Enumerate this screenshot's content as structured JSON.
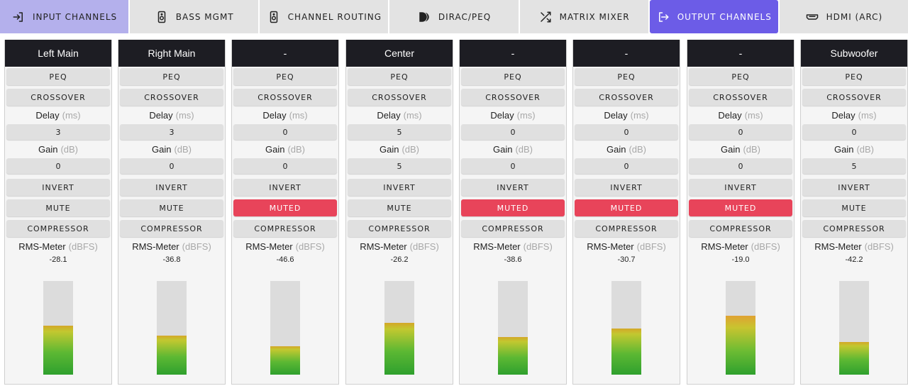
{
  "tabs": [
    {
      "label": "INPUT CHANNELS",
      "icon": "input-icon",
      "state": "first"
    },
    {
      "label": "BASS MGMT",
      "icon": "speaker-icon",
      "state": ""
    },
    {
      "label": "CHANNEL ROUTING",
      "icon": "speaker-icon",
      "state": ""
    },
    {
      "label": "DIRAC/PEQ",
      "icon": "dirac-icon",
      "state": ""
    },
    {
      "label": "MATRIX MIXER",
      "icon": "shuffle-icon",
      "state": ""
    },
    {
      "label": "OUTPUT CHANNELS",
      "icon": "output-icon",
      "state": "active"
    },
    {
      "label": "HDMI (ARC)",
      "icon": "hdmi-icon",
      "state": ""
    }
  ],
  "labels": {
    "peq": "PEQ",
    "crossover": "CROSSOVER",
    "delay": "Delay",
    "delay_unit": "(ms)",
    "gain": "Gain",
    "gain_unit": "(dB)",
    "invert": "INVERT",
    "compressor": "COMPRESSOR",
    "rms": "RMS-Meter",
    "rms_unit": "(dBFS)"
  },
  "channels": [
    {
      "name": "Left Main",
      "delay": "3",
      "gain": "0",
      "mute_label": "MUTE",
      "muted": false,
      "rms": "-28.1",
      "level": 0.52
    },
    {
      "name": "Right Main",
      "delay": "3",
      "gain": "0",
      "mute_label": "MUTE",
      "muted": false,
      "rms": "-36.8",
      "level": 0.42
    },
    {
      "name": "-",
      "delay": "0",
      "gain": "0",
      "mute_label": "MUTED",
      "muted": true,
      "rms": "-46.6",
      "level": 0.3
    },
    {
      "name": "Center",
      "delay": "5",
      "gain": "5",
      "mute_label": "MUTE",
      "muted": false,
      "rms": "-26.2",
      "level": 0.55
    },
    {
      "name": "-",
      "delay": "0",
      "gain": "0",
      "mute_label": "MUTED",
      "muted": true,
      "rms": "-38.6",
      "level": 0.4
    },
    {
      "name": "-",
      "delay": "0",
      "gain": "0",
      "mute_label": "MUTED",
      "muted": true,
      "rms": "-30.7",
      "level": 0.49
    },
    {
      "name": "-",
      "delay": "0",
      "gain": "0",
      "mute_label": "MUTED",
      "muted": true,
      "rms": "-19.0",
      "level": 0.63
    },
    {
      "name": "Subwoofer",
      "delay": "0",
      "gain": "5",
      "mute_label": "MUTE",
      "muted": false,
      "rms": "-42.2",
      "level": 0.35
    }
  ],
  "colors": {
    "tab_first": "#b4b0ec",
    "tab_active": "#6c5ce7",
    "header_bg": "#1d1d23",
    "muted_bg": "#e8445a",
    "meter_green": "#2fa02e",
    "meter_yellow": "#c2c830"
  }
}
